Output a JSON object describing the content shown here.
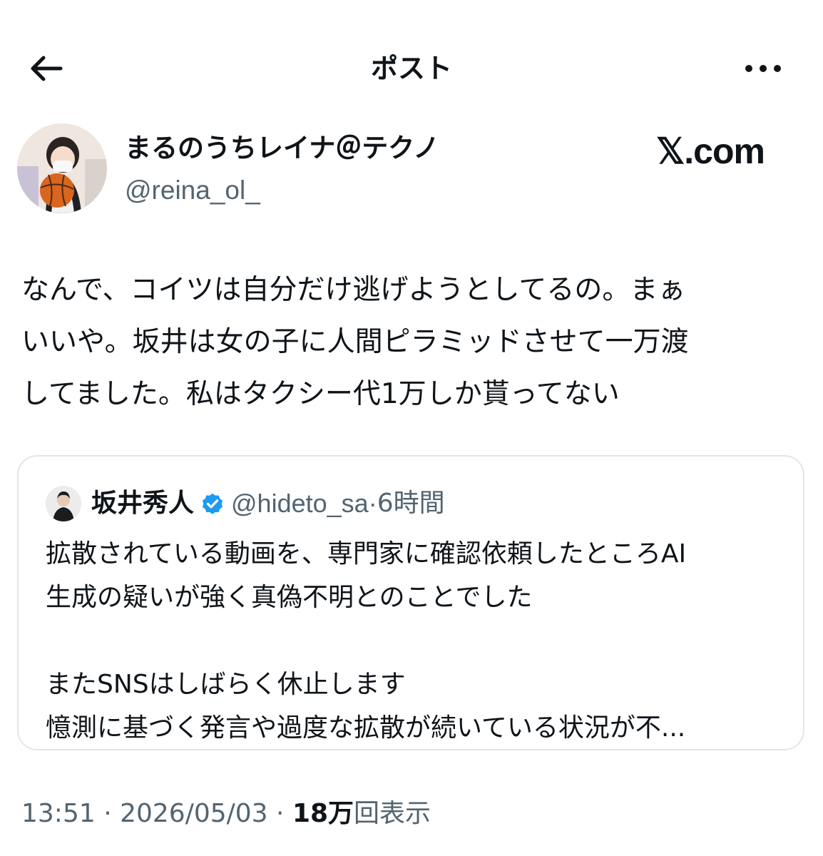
{
  "header": {
    "title": "ポスト",
    "back_icon": "arrow-left-icon",
    "more_icon": "more-horizontal-icon"
  },
  "author": {
    "name": "まるのうちレイナ＠テクノ",
    "handle": "@reina_ol_"
  },
  "watermark": "𝕏.com",
  "post": {
    "lines": [
      "なんで、コイツは自分だけ逃げようとしてるの。まぁ",
      "いいや。坂井は女の子に人間ピラミッドさせて一万渡",
      "してました。私はタクシー代1万しか貰ってない"
    ]
  },
  "quote": {
    "name": "坂井秀人",
    "handle": "@hideto_sa",
    "separator": "·",
    "time": "6時間",
    "verified_color": "#1d9bf0",
    "lines": [
      "拡散されている動画を、専門家に確認依頼したところAI",
      "生成の疑いが強く真偽不明とのことでした",
      "",
      "またSNSはしばらく休止します",
      "憶測に基づく発言や過度な拡散が続いている状況が不..."
    ]
  },
  "meta": {
    "time": "13:51",
    "sep1": " · ",
    "date": "2026/05/03",
    "sep2": " · ",
    "views_count": "18万",
    "views_label": "回表示"
  },
  "colors": {
    "text": "#0f1419",
    "secondary": "#536471",
    "border": "#e1e6ea",
    "accent": "#1d9bf0"
  }
}
